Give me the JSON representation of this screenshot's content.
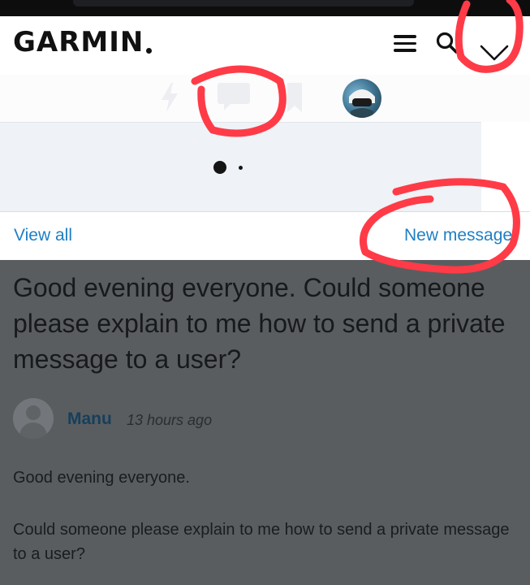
{
  "header": {
    "brand": "GARMIN",
    "icons": [
      "menu-icon",
      "search-icon",
      "chevron-down-icon"
    ]
  },
  "icon_row": {
    "icons": [
      "lightning-icon",
      "chat-icon",
      "bookmark-icon",
      "user-avatar"
    ]
  },
  "notifications_panel": {
    "carousel_pages": 2,
    "active_page": 1,
    "view_all_label": "View all",
    "new_message_label": "New message"
  },
  "post": {
    "title": "Good evening everyone. Could someone please explain to me how to send a private message to a user?",
    "author": "Manu",
    "timestamp": "13 hours ago",
    "body": [
      "Good evening everyone.",
      "Could someone please explain to me how to send a private message to a user?"
    ]
  },
  "colors": {
    "link": "#1f7fc4",
    "annotation": "#ff3b47",
    "overlay": "#5a5d60"
  }
}
